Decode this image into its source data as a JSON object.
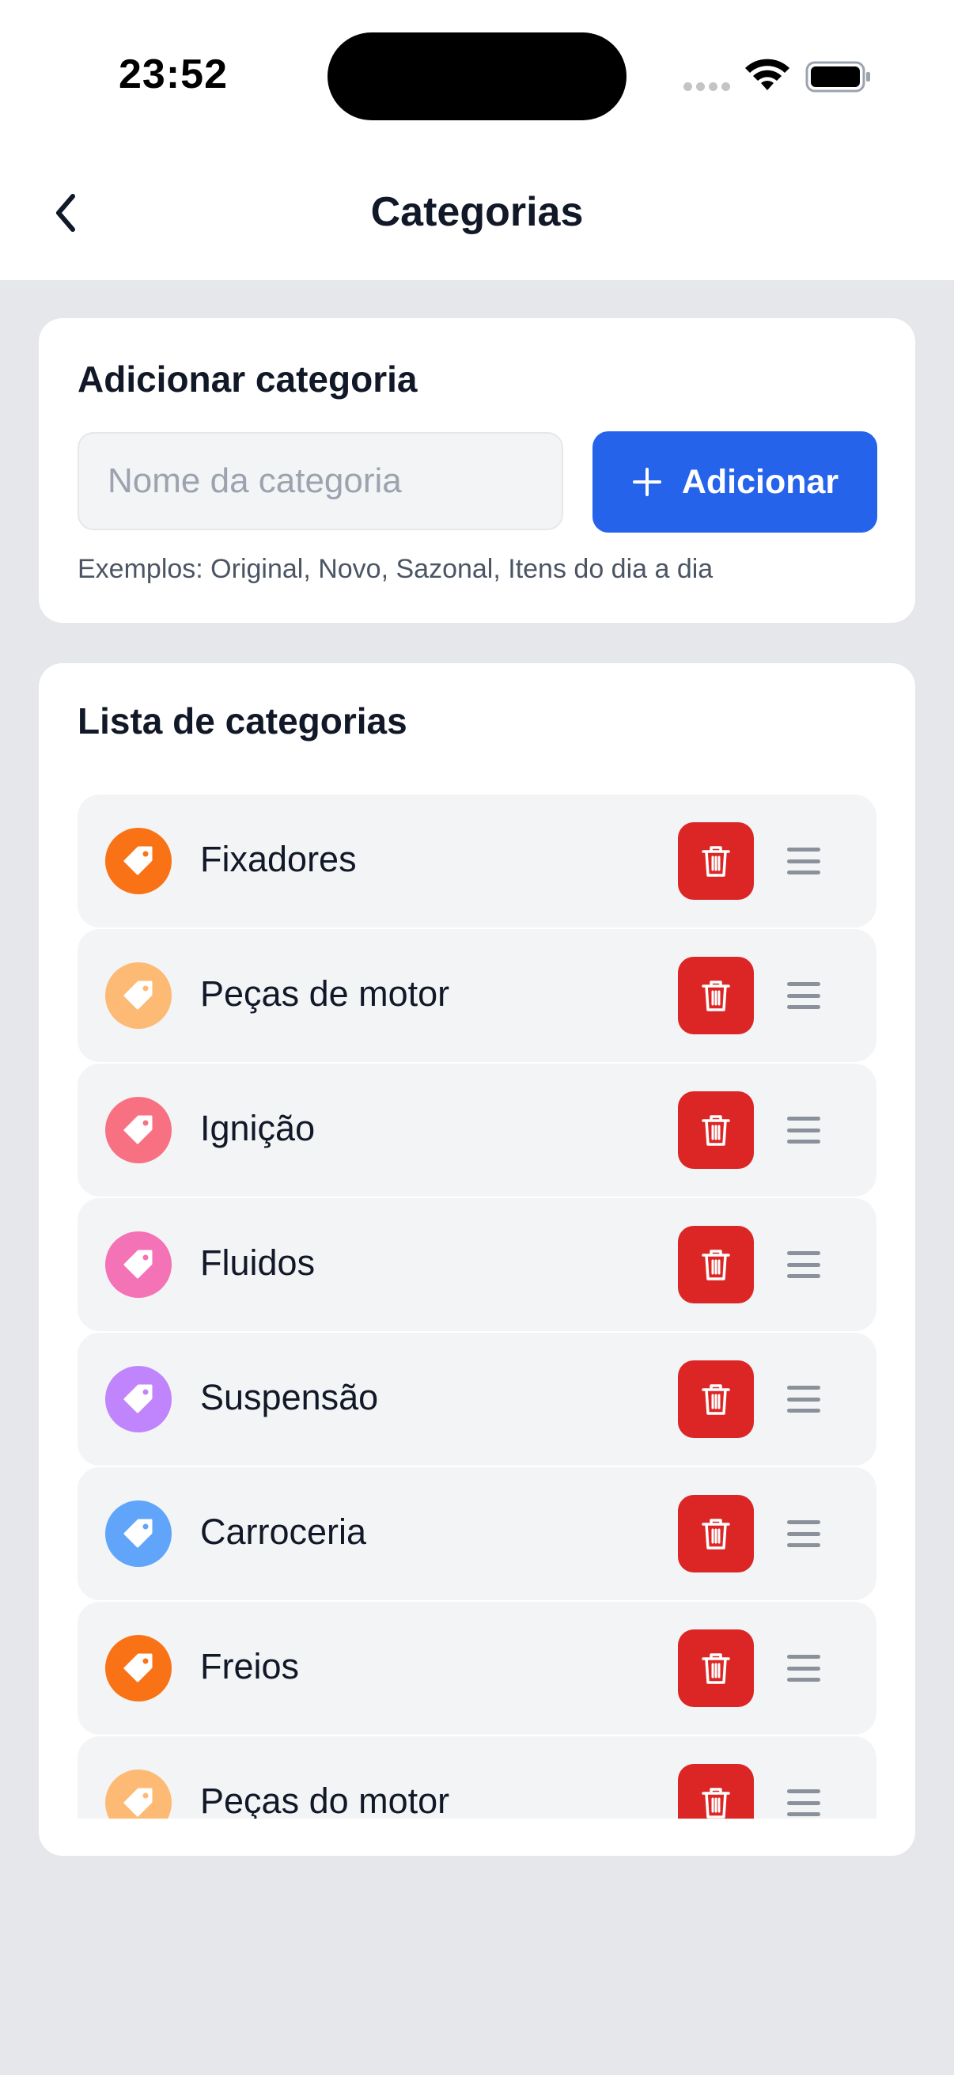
{
  "status_bar": {
    "time": "23:52"
  },
  "header": {
    "title": "Categorias",
    "back_icon": "chevron-left-icon"
  },
  "add_card": {
    "title": "Adicionar categoria",
    "input_placeholder": "Nome da categoria",
    "input_value": "",
    "button_label": "Adicionar",
    "button_icon": "plus-icon",
    "hint": "Exemplos: Original, Novo, Sazonal, Itens do dia a dia"
  },
  "list_card": {
    "title": "Lista de categorias",
    "items": [
      {
        "label": "Fixadores",
        "color": "#f97316"
      },
      {
        "label": "Peças de motor",
        "color": "#fdba74"
      },
      {
        "label": "Ignição",
        "color": "#f87183"
      },
      {
        "label": "Fluidos",
        "color": "#f472b6"
      },
      {
        "label": "Suspensão",
        "color": "#c084fc"
      },
      {
        "label": "Carroceria",
        "color": "#60a5fa"
      },
      {
        "label": "Freios",
        "color": "#f97316"
      },
      {
        "label": "Peças do motor",
        "color": "#fdba74"
      }
    ]
  },
  "colors": {
    "accent": "#2563eb",
    "danger": "#dc2626",
    "background": "#e5e7eb"
  }
}
